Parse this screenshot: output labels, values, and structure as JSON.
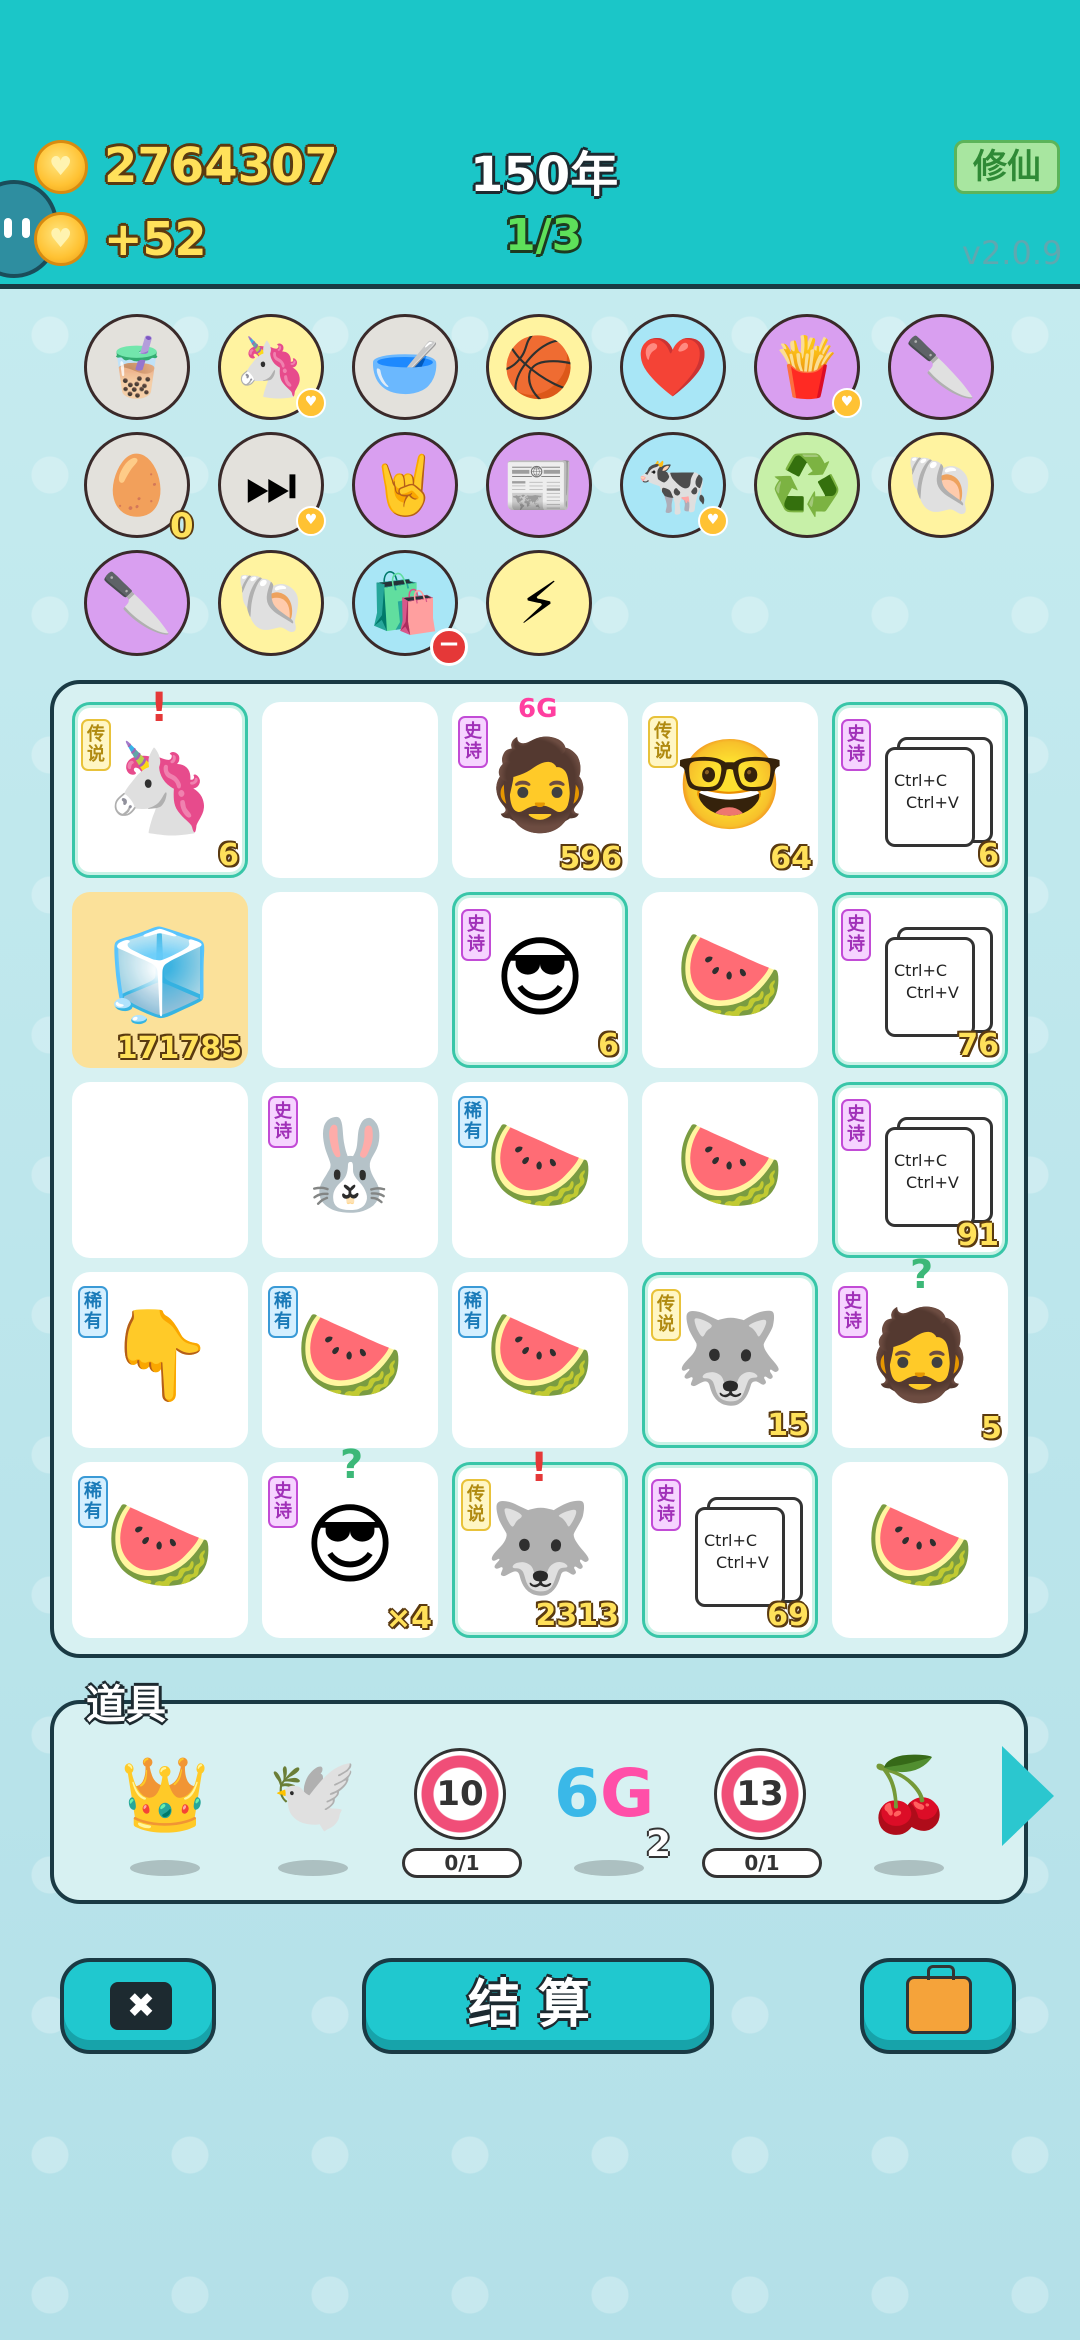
{
  "header": {
    "coins": "2764307",
    "income": "+52",
    "year": "150年",
    "progress": "1/3",
    "cultivate_button": "修仙",
    "version": "v2.0.9"
  },
  "collection": {
    "items": [
      {
        "icon": "bubble-tea-icon",
        "glyph": "🧋",
        "bg": "gray"
      },
      {
        "icon": "unicorn-icon",
        "glyph": "🦄",
        "bg": "yellow",
        "heart": true
      },
      {
        "icon": "pet-bowl-icon",
        "glyph": "🥣",
        "bg": "gray"
      },
      {
        "icon": "basketballs-icon",
        "glyph": "🏀",
        "bg": "yellow"
      },
      {
        "icon": "heart-fan-icon",
        "glyph": "❤️",
        "bg": "blue"
      },
      {
        "icon": "fries-icon",
        "glyph": "🍟",
        "bg": "purple",
        "heart": true
      },
      {
        "icon": "cleaver-icon",
        "glyph": "🔪",
        "bg": "purple"
      },
      {
        "icon": "egg-tray-icon",
        "glyph": "🥚",
        "bg": "gray",
        "count": "0"
      },
      {
        "icon": "play-next-icon",
        "glyph": "⏭",
        "bg": "gray",
        "heart": true
      },
      {
        "icon": "rock-hand-icon",
        "glyph": "🤘",
        "bg": "purple"
      },
      {
        "icon": "time-magazine-icon",
        "glyph": "📰",
        "bg": "purple"
      },
      {
        "icon": "cow-pair-icon",
        "glyph": "🐄",
        "bg": "blue",
        "heart": true
      },
      {
        "icon": "recycle-icon",
        "glyph": "♻️",
        "bg": "green"
      },
      {
        "icon": "shell-icon",
        "glyph": "🐚",
        "bg": "yellow"
      },
      {
        "icon": "cleaver-icon",
        "glyph": "🔪",
        "bg": "purple"
      },
      {
        "icon": "shell-icon",
        "glyph": "🐚",
        "bg": "yellow"
      },
      {
        "icon": "seed-bag-icon",
        "glyph": "🛍️",
        "bg": "blue",
        "minus": true
      },
      {
        "icon": "lightning-icon",
        "glyph": "⚡",
        "bg": "yellow"
      }
    ]
  },
  "board": {
    "cells": [
      {
        "tag": "传说",
        "tagType": "leg",
        "icon": "unicorn-icon",
        "glyph": "🦄",
        "count": "6",
        "highlight": true,
        "mark": "!"
      },
      {
        "empty": true
      },
      {
        "tag": "史诗",
        "tagType": "epic",
        "icon": "bearded-man-icon",
        "glyph": "🧔",
        "count": "596",
        "badge": "6G"
      },
      {
        "tag": "传说",
        "tagType": "leg",
        "icon": "bald-glasses-man-icon",
        "glyph": "🤓",
        "count": "64"
      },
      {
        "tag": "史诗",
        "tagType": "epic",
        "icon": "copy-paste-cards-icon",
        "card": true,
        "count": "6",
        "highlight": true
      },
      {
        "icon": "fridge-icon",
        "glyph": "🧊",
        "count": "171785",
        "gold": true
      },
      {
        "empty": true
      },
      {
        "tag": "史诗",
        "tagType": "epic",
        "icon": "sunglasses-man-icon",
        "glyph": "😎",
        "count": "6",
        "highlight": true
      },
      {
        "icon": "watermelon-slice-icon",
        "glyph": "🍉"
      },
      {
        "tag": "史诗",
        "tagType": "epic",
        "icon": "copy-paste-cards-icon",
        "card": true,
        "count": "76",
        "highlight": true
      },
      {
        "empty": true
      },
      {
        "tag": "史诗",
        "tagType": "epic",
        "icon": "rabbit-tent-icon",
        "glyph": "🐰"
      },
      {
        "tag": "稀有",
        "tagType": "rare",
        "icon": "watermelon-icon",
        "glyph": "🍉"
      },
      {
        "icon": "watermelon-slice-icon",
        "glyph": "🍉"
      },
      {
        "tag": "史诗",
        "tagType": "epic",
        "icon": "copy-paste-cards-icon",
        "card": true,
        "count": "91",
        "highlight": true
      },
      {
        "tag": "稀有",
        "tagType": "rare",
        "icon": "pointing-hand-icon",
        "glyph": "👇"
      },
      {
        "tag": "稀有",
        "tagType": "rare",
        "icon": "watermelon-icon",
        "glyph": "🍉"
      },
      {
        "tag": "稀有",
        "tagType": "rare",
        "icon": "watermelon-icon",
        "glyph": "🍉"
      },
      {
        "tag": "传说",
        "tagType": "leg",
        "icon": "husky-king-icon",
        "glyph": "🐺",
        "count": "15",
        "highlight": true
      },
      {
        "tag": "史诗",
        "tagType": "epic",
        "icon": "bearded-man-icon",
        "glyph": "🧔",
        "count": "5",
        "mark": "?"
      },
      {
        "tag": "稀有",
        "tagType": "rare",
        "icon": "watermelon-icon",
        "glyph": "🍉"
      },
      {
        "tag": "史诗",
        "tagType": "epic",
        "icon": "sunglasses-man-icon",
        "glyph": "😎",
        "count": "×4",
        "mark": "?"
      },
      {
        "tag": "传说",
        "tagType": "leg",
        "icon": "husky-king-icon",
        "glyph": "🐺",
        "count": "2313",
        "highlight": true,
        "mark": "!"
      },
      {
        "tag": "史诗",
        "tagType": "epic",
        "icon": "copy-paste-cards-icon",
        "card": true,
        "count": "69",
        "highlight": true
      },
      {
        "icon": "watermelon-slice-icon",
        "glyph": "🍉"
      }
    ],
    "card_text_1": "Ctrl+C",
    "card_text_2": "Ctrl+V"
  },
  "props": {
    "title": "道具",
    "items": [
      {
        "icon": "crown-icon",
        "glyph": "👑"
      },
      {
        "icon": "dove-icon",
        "glyph": "🕊️"
      },
      {
        "icon": "target-10-icon",
        "ring": "10",
        "pill": "0/1"
      },
      {
        "icon": "sixg-icon",
        "sixg_a": "6",
        "sixg_b": "G",
        "count": "2"
      },
      {
        "icon": "target-13-icon",
        "ring": "13",
        "pill": "0/1"
      },
      {
        "icon": "lychee-icon",
        "glyph": "🍒"
      }
    ]
  },
  "buttons": {
    "settle": "结算",
    "close_icon": "✖"
  },
  "colors": {
    "header_bg": "#1bc6c8",
    "board_bg": "#d7f1f2",
    "accent": "#20c8cf",
    "coin_text": "#ffe15a",
    "progress_text": "#5ee05a"
  }
}
